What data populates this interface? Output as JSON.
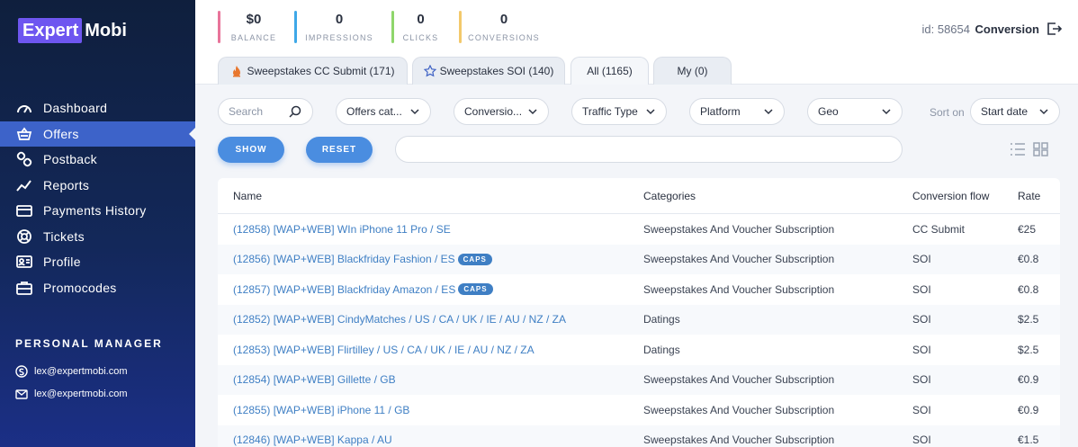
{
  "logo": {
    "part1": "Expert",
    "part2": "Mobi"
  },
  "nav": [
    {
      "label": "Dashboard",
      "icon": "gauge-icon"
    },
    {
      "label": "Offers",
      "icon": "basket-icon"
    },
    {
      "label": "Postback",
      "icon": "link-icon"
    },
    {
      "label": "Reports",
      "icon": "chart-line-icon"
    },
    {
      "label": "Payments History",
      "icon": "credit-card-icon"
    },
    {
      "label": "Tickets",
      "icon": "lifebuoy-icon"
    },
    {
      "label": "Profile",
      "icon": "id-card-icon"
    },
    {
      "label": "Promocodes",
      "icon": "briefcase-icon"
    }
  ],
  "personal_manager": {
    "title": "PERSONAL MANAGER",
    "skype": "lex@expertmobi.com",
    "email": "lex@expertmobi.com"
  },
  "stats": [
    {
      "value": "$0",
      "label": "BALANCE",
      "color": "#e8749a"
    },
    {
      "value": "0",
      "label": "IMPRESSIONS",
      "color": "#3ea8e8"
    },
    {
      "value": "0",
      "label": "CLICKS",
      "color": "#8fd66b"
    },
    {
      "value": "0",
      "label": "CONVERSIONS",
      "color": "#f3c96b"
    }
  ],
  "header": {
    "user_id": "id: 58654",
    "conversion_link": "Conversion"
  },
  "tabs": [
    {
      "label": "Sweepstakes CC Submit (171)",
      "icon": "fire-icon"
    },
    {
      "label": "Sweepstakes SOI (140)",
      "icon": "star-icon"
    },
    {
      "label": "All (1165)",
      "icon": ""
    },
    {
      "label": "My (0)",
      "icon": ""
    }
  ],
  "filters": {
    "search_placeholder": "Search",
    "offers_category": "Offers cat...",
    "conversion": "Conversio...",
    "traffic_type": "Traffic Type",
    "platform": "Platform",
    "geo": "Geo",
    "sort_label": "Sort on",
    "sort_value": "Start date",
    "show_button": "SHOW",
    "reset_button": "RESET"
  },
  "table": {
    "columns": [
      "Name",
      "Categories",
      "Conversion flow",
      "Rate"
    ],
    "rows": [
      {
        "name": "(12858) [WAP+WEB] WIn iPhone 11 Pro / SE",
        "caps": "",
        "category": "Sweepstakes And Voucher Subscription",
        "flow": "CC Submit",
        "rate": "€25"
      },
      {
        "name": "(12856) [WAP+WEB] Blackfriday Fashion / ES",
        "caps": "CAPS",
        "category": "Sweepstakes And Voucher Subscription",
        "flow": "SOI",
        "rate": "€0.8"
      },
      {
        "name": "(12857) [WAP+WEB] Blackfriday Amazon / ES",
        "caps": "CAPS",
        "category": "Sweepstakes And Voucher Subscription",
        "flow": "SOI",
        "rate": "€0.8"
      },
      {
        "name": "(12852) [WAP+WEB] CindyMatches / US / CA / UK / IE / AU / NZ / ZA",
        "caps": "",
        "category": "Datings",
        "flow": "SOI",
        "rate": "$2.5"
      },
      {
        "name": "(12853) [WAP+WEB] Flirtilley / US / CA / UK / IE / AU / NZ / ZA",
        "caps": "",
        "category": "Datings",
        "flow": "SOI",
        "rate": "$2.5"
      },
      {
        "name": "(12854) [WAP+WEB] Gillette / GB",
        "caps": "",
        "category": "Sweepstakes And Voucher Subscription",
        "flow": "SOI",
        "rate": "€0.9"
      },
      {
        "name": "(12855) [WAP+WEB] iPhone 11 / GB",
        "caps": "",
        "category": "Sweepstakes And Voucher Subscription",
        "flow": "SOI",
        "rate": "€0.9"
      },
      {
        "name": "(12846) [WAP+WEB] Kappa / AU",
        "caps": "",
        "category": "Sweepstakes And Voucher Subscription",
        "flow": "SOI",
        "rate": "€1.5"
      }
    ]
  }
}
